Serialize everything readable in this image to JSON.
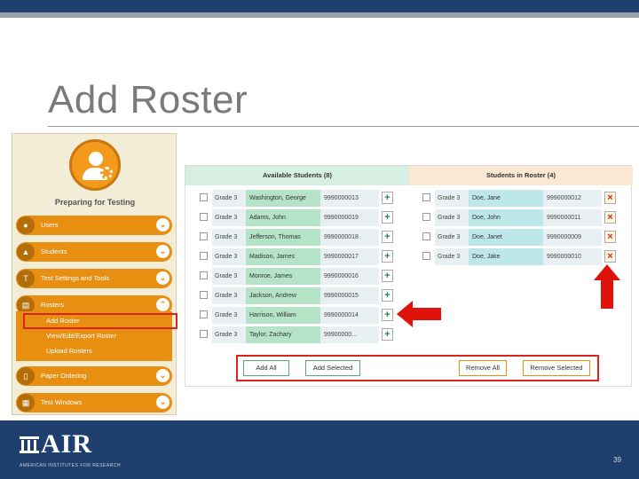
{
  "slide": {
    "title": "Add Roster",
    "page_number": "39"
  },
  "nav": {
    "heading": "Preparing for Testing",
    "items": [
      {
        "label": "Users",
        "icon": "users-icon",
        "chevron": "⌄"
      },
      {
        "label": "Students",
        "icon": "graduation-cap-icon",
        "chevron": "⌄"
      },
      {
        "label": "Test Settings and Tools",
        "icon": "settings-tools-icon",
        "chevron": "⌄"
      },
      {
        "label": "Rosters",
        "icon": "roster-icon",
        "chevron": "⌃"
      },
      {
        "label": "Paper Ordering",
        "icon": "paper-icon",
        "chevron": "⌄"
      },
      {
        "label": "Test Windows",
        "icon": "calendar-icon",
        "chevron": "⌄"
      }
    ],
    "rosters_sub": [
      "Add Roster",
      "View/Edit/Export Roster",
      "Upload Rosters"
    ]
  },
  "roster": {
    "available_header": "Available Students (8)",
    "in_roster_header": "Students in Roster (4)",
    "available": [
      {
        "grade": "Grade 3",
        "name": "Washington, George",
        "id": "9990000013"
      },
      {
        "grade": "Grade 3",
        "name": "Adams, John",
        "id": "9990000019"
      },
      {
        "grade": "Grade 3",
        "name": "Jefferson, Thomas",
        "id": "9990000018"
      },
      {
        "grade": "Grade 3",
        "name": "Madison, James",
        "id": "9990000017"
      },
      {
        "grade": "Grade 3",
        "name": "Monroe, James",
        "id": "9990000016"
      },
      {
        "grade": "Grade 3",
        "name": "Jackson, Andrew",
        "id": "9990000015"
      },
      {
        "grade": "Grade 3",
        "name": "Harrison, William",
        "id": "9990000014"
      },
      {
        "grade": "Grade 3",
        "name": "Taylor, Zachary",
        "id": "99900000..."
      }
    ],
    "in_roster": [
      {
        "grade": "Grade 3",
        "name": "Doe, Jane",
        "id": "9990000012"
      },
      {
        "grade": "Grade 3",
        "name": "Doe, John",
        "id": "9990000011"
      },
      {
        "grade": "Grade 3",
        "name": "Doe, Janet",
        "id": "9990000009"
      },
      {
        "grade": "Grade 3",
        "name": "Doe, Jake",
        "id": "9990000010"
      }
    ],
    "add_symbol": "+",
    "remove_symbol": "×",
    "buttons": {
      "add_all": "Add All",
      "add_selected": "Add Selected",
      "remove_all": "Remove All",
      "remove_selected": "Remove Selected"
    }
  },
  "footer": {
    "logo_text": "AIR",
    "logo_sub": "AMERICAN INSTITUTES FOR RESEARCH"
  },
  "colors": {
    "accent_orange": "#e88f12",
    "footer_blue": "#1f3f6f",
    "highlight_red": "#d9251c"
  }
}
